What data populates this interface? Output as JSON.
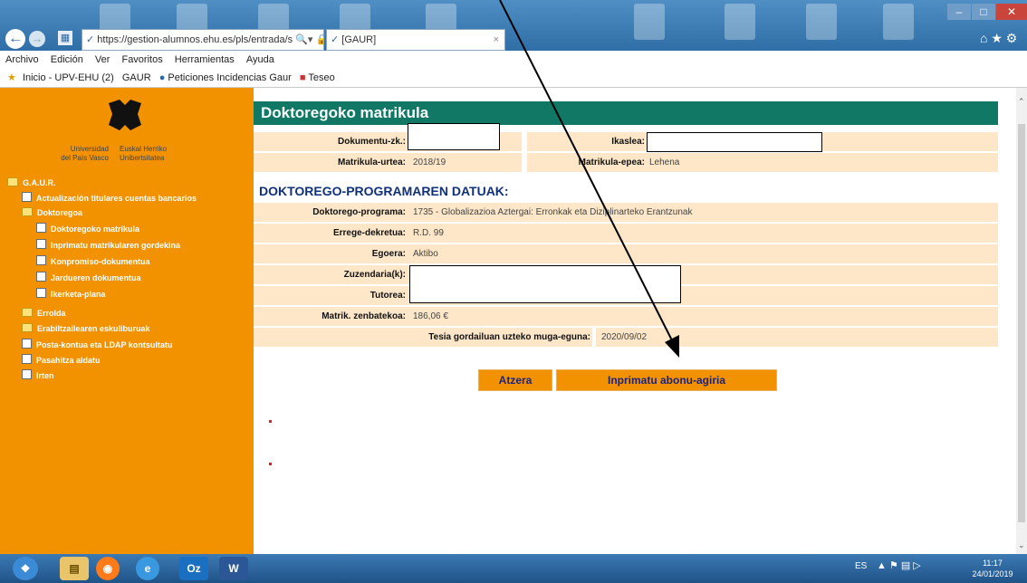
{
  "browser": {
    "url": "https://gestion-alumnos.ehu.es/pls/entrada/s",
    "tab_title": "[GAUR]",
    "menu": [
      "Archivo",
      "Edición",
      "Ver",
      "Favoritos",
      "Herramientas",
      "Ayuda"
    ],
    "favorites": [
      "Inicio - UPV-EHU (2)",
      "GAUR",
      "Peticiones Incidencias Gaur",
      "Teseo"
    ]
  },
  "sidebar": {
    "logo_lines": [
      "Universidad",
      "del País Vasco",
      "Euskal Herriko",
      "Unibertsitatea"
    ],
    "root": "G.A.U.R.",
    "items": [
      {
        "label": "Actualización titulares cuentas bancarios"
      },
      {
        "label": "Doktoregoa"
      },
      {
        "label": "Doktoregoko matrikula"
      },
      {
        "label": "Inprimatu matrikularen gordekina"
      },
      {
        "label": "Konpromiso-dokumentua"
      },
      {
        "label": "Jardueren dokumentua"
      },
      {
        "label": "Ikerketa-plana"
      },
      {
        "label": "Errolda"
      },
      {
        "label": "Erabiltzailearen eskuliburuak"
      },
      {
        "label": "Posta-kontua eta LDAP kontsultatu"
      },
      {
        "label": "Pasahitza aldatu"
      },
      {
        "label": "Irten"
      }
    ]
  },
  "main": {
    "title": "Doktoregoko matrikula",
    "fields": {
      "dokumentu_label": "Dokumentu-zk.:",
      "ikaslea_label": "Ikaslea:",
      "urtea_label": "Matrikula-urtea:",
      "urtea_value": "2018/19",
      "epea_label": "Matrikula-epea:",
      "epea_value": "Lehena"
    },
    "section_title": "DOKTOREGO-PROGRAMAREN DATUAK:",
    "program": {
      "programa_label": "Doktorego-programa:",
      "programa_value": "1735 - Globalizazioa Aztergai: Erronkak eta Diziplinarteko Erantzunak",
      "dekretua_label": "Errege-dekretua:",
      "dekretua_value": "R.D. 99",
      "egoera_label": "Egoera:",
      "egoera_value": "Aktibo",
      "zuzendaria_label": "Zuzendaria(k):",
      "tutorea_label": "Tutorea:",
      "zenbatekoa_label": "Matrik. zenbatekoa:",
      "zenbatekoa_value": "186,06 €",
      "muga_label": "Tesia gordailuan uzteko muga-eguna:",
      "muga_value": "2020/09/02"
    },
    "buttons": {
      "back": "Atzera",
      "print": "Inprimatu abonu-agiria"
    }
  },
  "taskbar": {
    "lang": "ES",
    "time": "11:17",
    "date": "24/01/2019"
  }
}
